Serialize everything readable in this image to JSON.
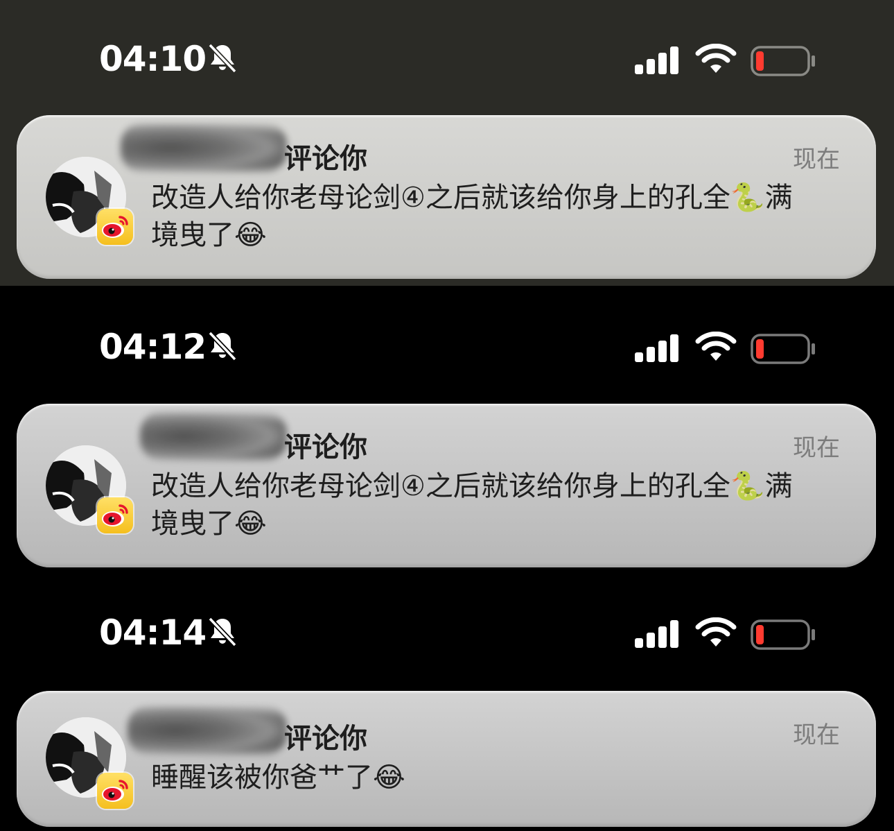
{
  "screens": [
    {
      "status_bar": {
        "time": "04:10",
        "mute_icon": "bell-slash-icon",
        "signal_icon": "cellular-signal-icon",
        "wifi_icon": "wifi-icon",
        "battery_icon": "battery-low-icon",
        "battery_color": "#ff3b30"
      },
      "notification": {
        "app_icon": "weibo-app-icon",
        "sender_redacted": true,
        "title_suffix": "评论你",
        "timestamp": "现在",
        "message": "改造人给你老母论剑④之后就该给你身上的孔全🐍满境曳了😂"
      }
    },
    {
      "status_bar": {
        "time": "04:12",
        "mute_icon": "bell-slash-icon",
        "signal_icon": "cellular-signal-icon",
        "wifi_icon": "wifi-icon",
        "battery_icon": "battery-low-icon",
        "battery_color": "#ff3b30"
      },
      "notification": {
        "app_icon": "weibo-app-icon",
        "sender_redacted": true,
        "title_suffix": "评论你",
        "timestamp": "现在",
        "message": "改造人给你老母论剑④之后就该给你身上的孔全🐍满境曳了😂"
      }
    },
    {
      "status_bar": {
        "time": "04:14",
        "mute_icon": "bell-slash-icon",
        "signal_icon": "cellular-signal-icon",
        "wifi_icon": "wifi-icon",
        "battery_icon": "battery-low-icon",
        "battery_color": "#ff3b30"
      },
      "notification": {
        "app_icon": "weibo-app-icon",
        "sender_redacted": true,
        "title_suffix": "评论你",
        "timestamp": "现在",
        "message": "睡醒该被你爸艹了😂"
      }
    }
  ]
}
